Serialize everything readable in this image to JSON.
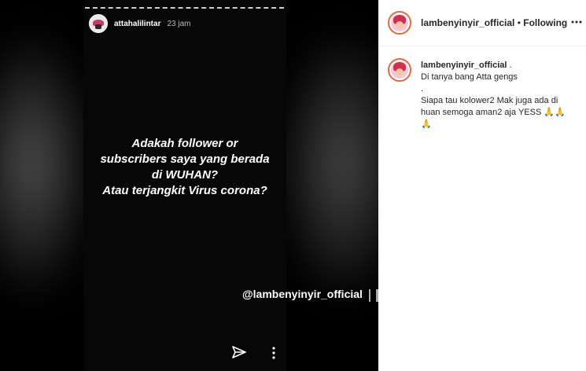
{
  "story": {
    "username": "attahalilintar",
    "time": "23 jam",
    "text_lines": [
      "Adakah follower or",
      "subscribers saya yang berada",
      "di WUHAN?",
      "Atau terjangkit Virus corona?"
    ],
    "watermark": "@lambenyinyir_official"
  },
  "post": {
    "username": "lambenyinyir_official",
    "separator": "•",
    "follow_status": "Following",
    "caption_username": "lambenyinyir_official",
    "caption_lines": [
      " .",
      "Di tanya bang Atta gengs",
      ".",
      "Siapa tau kolower2 Mak juga ada di",
      "huan semoga aman2 aja YESS 🙏🙏",
      "🙏"
    ]
  },
  "icons": {
    "send": "send-icon",
    "story_menu": "more-vertical-icon",
    "post_menu": "more-horizontal-icon"
  },
  "colors": {
    "avatar_ring": "#e6683c",
    "panel_bg": "#ffffff",
    "media_bg": "#000000"
  }
}
